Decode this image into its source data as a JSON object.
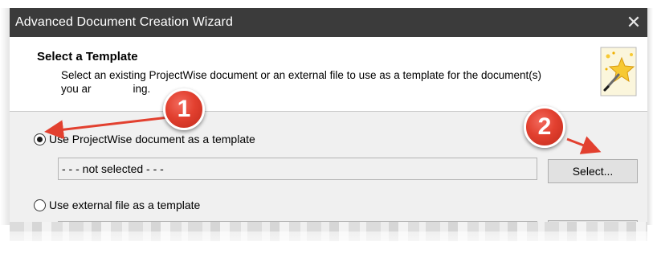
{
  "window": {
    "title": "Advanced Document Creation Wizard",
    "close_icon": "close-icon"
  },
  "header": {
    "title": "Select a Template",
    "description": "Select an existing ProjectWise document or an external file to use as a template for the document(s) you ar",
    "description_tail": "ing.",
    "icon": "magic-wand-icon"
  },
  "options": {
    "projectwise": {
      "label": "Use ProjectWise document as a template",
      "selected": true,
      "value": "- - - not selected - - -",
      "button_label": "Select..."
    },
    "external": {
      "label": "Use external file as a template",
      "selected": false
    }
  },
  "annotations": {
    "badge_1": "1",
    "badge_2": "2",
    "color": "#e2402f"
  },
  "colors": {
    "titlebar": "#3b3b3b",
    "dialog_bg": "#f0f0f0",
    "header_bg": "#ffffff"
  }
}
